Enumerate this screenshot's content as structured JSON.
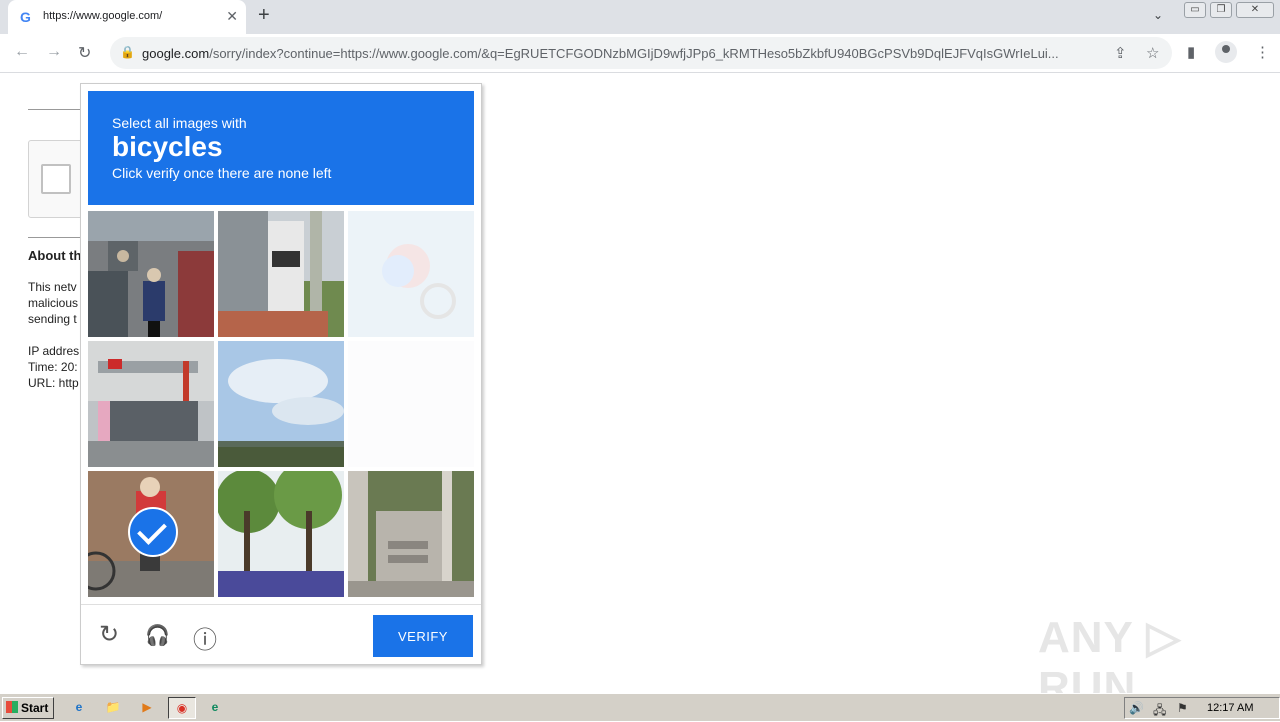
{
  "browser": {
    "tab": {
      "favicon": "G",
      "title": "https://www.google.com/",
      "close": "✕"
    },
    "new_tab": "+",
    "tab_dropdown": "⌄",
    "window_controls": {
      "minimize": "▭",
      "restore": "❐",
      "close": "✕"
    },
    "nav": {
      "back": "←",
      "forward": "→",
      "reload": "↻"
    },
    "address": {
      "lock": "🔒",
      "host": "google.com",
      "rest": "/sorry/index?continue=https://www.google.com/&q=EgRUETCFGODNzbMGIjD9wfjJPp6_kRMTHeso5bZkbfU940BGcPSVb9DqlEJFVqIsGWrIeLui..."
    },
    "icons": {
      "share": "⇪",
      "bookmark": "☆",
      "sidepanel": "▮",
      "menu": "⋮"
    }
  },
  "background_page": {
    "heading": "About th",
    "line1": "This netv",
    "line2": "malicious",
    "line3": "sending t",
    "ip": "IP addres",
    "time": "Time: 20:",
    "url": "URL: http"
  },
  "captcha": {
    "instruction": "Select all images with",
    "target": "bicycles",
    "hint": "Click verify once there are none left",
    "verify_label": "VERIFY",
    "tiles": [
      {
        "name": "tile-motorbikes-street",
        "selected": false,
        "faded": false
      },
      {
        "name": "tile-bus-pole",
        "selected": false,
        "faded": false
      },
      {
        "name": "tile-fading-bicycle",
        "selected": true,
        "faded": true
      },
      {
        "name": "tile-storefront",
        "selected": false,
        "faded": false
      },
      {
        "name": "tile-sky-bridge",
        "selected": false,
        "faded": false
      },
      {
        "name": "tile-blank-loading",
        "selected": false,
        "faded": true
      },
      {
        "name": "tile-child-bicycle",
        "selected": true,
        "faded": false
      },
      {
        "name": "tile-trees-flowers",
        "selected": false,
        "faded": false
      },
      {
        "name": "tile-stairs-wall",
        "selected": false,
        "faded": false
      }
    ],
    "footer_icons": {
      "reload": "↻",
      "audio": "🎧",
      "info": "ⓘ"
    }
  },
  "watermark": "ANY ▷ RUN",
  "taskbar": {
    "start_label": "Start",
    "apps": [
      "e",
      "📁",
      "▶",
      "◉",
      "e"
    ],
    "clock": "12:17 AM",
    "tray_icons": [
      "🔊",
      "🖧",
      "⚑"
    ]
  }
}
